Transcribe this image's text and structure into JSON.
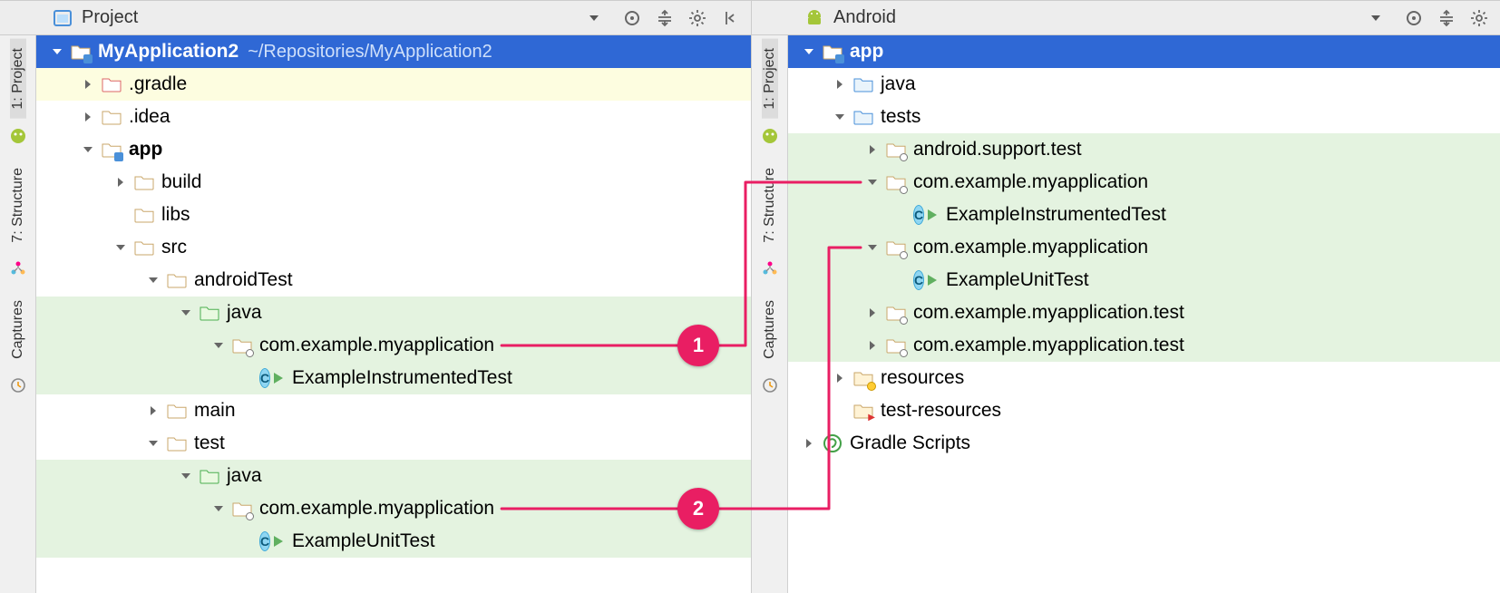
{
  "left": {
    "header": {
      "view": "Project"
    },
    "sideTabs": {
      "project": "1: Project",
      "structure": "7: Structure",
      "captures": "Captures"
    },
    "rows": [
      {
        "id": "root",
        "indent": 0,
        "arrow": "down",
        "icon": "module",
        "label": "MyApplication2",
        "subpath": "~/Repositories/MyApplication2",
        "bold": true,
        "cls": "selected"
      },
      {
        "id": "gradle",
        "indent": 34,
        "arrow": "right",
        "icon": "folder-red",
        "label": ".gradle",
        "cls": "hly"
      },
      {
        "id": "idea",
        "indent": 34,
        "arrow": "right",
        "icon": "folder",
        "label": ".idea"
      },
      {
        "id": "app",
        "indent": 34,
        "arrow": "down",
        "icon": "module",
        "label": "app",
        "bold": true
      },
      {
        "id": "build",
        "indent": 70,
        "arrow": "right",
        "icon": "folder",
        "label": "build"
      },
      {
        "id": "libs",
        "indent": 70,
        "arrow": "none",
        "icon": "folder",
        "label": "libs"
      },
      {
        "id": "src",
        "indent": 70,
        "arrow": "down",
        "icon": "folder",
        "label": "src"
      },
      {
        "id": "at",
        "indent": 106,
        "arrow": "down",
        "icon": "folder",
        "label": "androidTest"
      },
      {
        "id": "atj",
        "indent": 142,
        "arrow": "down",
        "icon": "folder-green",
        "label": "java",
        "cls": "hl"
      },
      {
        "id": "atpkg",
        "indent": 178,
        "arrow": "down",
        "icon": "package",
        "label": "com.example.myapplication",
        "cls": "hl",
        "anchor": "left-1"
      },
      {
        "id": "atcls",
        "indent": 214,
        "arrow": "none",
        "icon": "class",
        "label": "ExampleInstrumentedTest",
        "cls": "hl"
      },
      {
        "id": "main",
        "indent": 106,
        "arrow": "right",
        "icon": "folder",
        "label": "main"
      },
      {
        "id": "test",
        "indent": 106,
        "arrow": "down",
        "icon": "folder",
        "label": "test"
      },
      {
        "id": "tj",
        "indent": 142,
        "arrow": "down",
        "icon": "folder-green",
        "label": "java",
        "cls": "hl"
      },
      {
        "id": "tpkg",
        "indent": 178,
        "arrow": "down",
        "icon": "package",
        "label": "com.example.myapplication",
        "cls": "hl",
        "anchor": "left-2"
      },
      {
        "id": "tcls",
        "indent": 214,
        "arrow": "none",
        "icon": "class",
        "label": "ExampleUnitTest",
        "cls": "hl"
      }
    ]
  },
  "right": {
    "header": {
      "view": "Android"
    },
    "sideTabs": {
      "project": "1: Project",
      "structure": "7: Structure",
      "captures": "Captures"
    },
    "rows": [
      {
        "id": "app",
        "indent": 0,
        "arrow": "down",
        "icon": "module",
        "label": "app",
        "bold": true,
        "cls": "selected"
      },
      {
        "id": "java",
        "indent": 34,
        "arrow": "right",
        "icon": "folder-blue",
        "label": "java"
      },
      {
        "id": "tests",
        "indent": 34,
        "arrow": "down",
        "icon": "folder-blue",
        "label": "tests"
      },
      {
        "id": "ast",
        "indent": 70,
        "arrow": "right",
        "icon": "package",
        "label": "android.support.test",
        "cls": "hl"
      },
      {
        "id": "p1",
        "indent": 70,
        "arrow": "down",
        "icon": "package",
        "label": "com.example.myapplication",
        "cls": "hl",
        "anchor": "right-1"
      },
      {
        "id": "c1",
        "indent": 106,
        "arrow": "none",
        "icon": "class",
        "label": "ExampleInstrumentedTest",
        "cls": "hl"
      },
      {
        "id": "p2",
        "indent": 70,
        "arrow": "down",
        "icon": "package",
        "label": "com.example.myapplication",
        "cls": "hl",
        "anchor": "right-2"
      },
      {
        "id": "c2",
        "indent": 106,
        "arrow": "none",
        "icon": "class",
        "label": "ExampleUnitTest",
        "cls": "hl"
      },
      {
        "id": "p3",
        "indent": 70,
        "arrow": "right",
        "icon": "package",
        "label": "com.example.myapplication.test",
        "cls": "hl"
      },
      {
        "id": "p4",
        "indent": 70,
        "arrow": "right",
        "icon": "package",
        "label": "com.example.myapplication.test",
        "cls": "hl"
      },
      {
        "id": "res",
        "indent": 34,
        "arrow": "right",
        "icon": "resources",
        "label": "resources"
      },
      {
        "id": "tres",
        "indent": 34,
        "arrow": "none",
        "icon": "test-res",
        "label": "test-resources"
      },
      {
        "id": "grad",
        "indent": 0,
        "arrow": "right",
        "icon": "gradle",
        "label": "Gradle Scripts"
      }
    ]
  },
  "callouts": {
    "one": "1",
    "two": "2"
  }
}
